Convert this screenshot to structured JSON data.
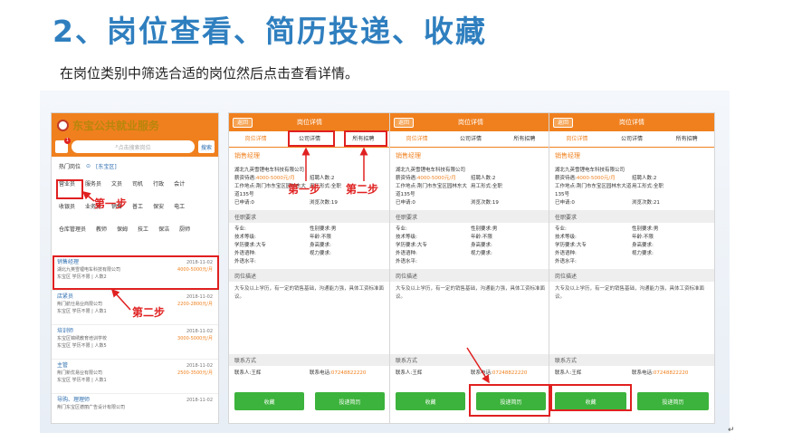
{
  "slide": {
    "title": "2、岗位查看、简历投递、收藏",
    "subtitle": "在岗位类别中筛选合适的岗位然后点击查看详情。"
  },
  "list_screen": {
    "brand": "东宝公共就业服务",
    "badge": "1",
    "search_placeholder": "点击搜索岗位",
    "search_button": "搜索",
    "hot_label": "热门岗位",
    "district": "[东宝区]",
    "tags": [
      "营业员",
      "服务员",
      "文员",
      "司机",
      "行政",
      "会计",
      "收银员",
      "业务员",
      "销售",
      "普工",
      "保安",
      "电工",
      "仓库管理员",
      "教师",
      "保姆",
      "技工",
      "保洁",
      "厨师"
    ],
    "jobs": [
      {
        "title": "销售经理",
        "date": "2018-11-02",
        "salary": "4000-5000元/月",
        "company": "湖北九英雪锂电车科技有限公司",
        "meta": "东宝区 学历不限 | 人数2"
      },
      {
        "title": "店紧员",
        "date": "2018-11-02",
        "salary": "2200-2800元/月",
        "company": "荆门航仕易业商限公司",
        "meta": "东宝区 学历不限 | 人数1"
      },
      {
        "title": "培训师",
        "date": "2018-11-02",
        "salary": "3000-5000元/月",
        "company": "东宝区锦绣教育培训学校",
        "meta": "东宝区 学历不限 | 人数5"
      },
      {
        "title": "主管",
        "date": "2018-11-02",
        "salary": "2500-3500元/月",
        "company": "荆门新优易业有限公司",
        "meta": "东宝区 学历不限 | 人数1"
      },
      {
        "title": "导购、理理师",
        "date": "2018-11-02",
        "salary": "",
        "company": "荆门东宝区德丽广告设计有限公司",
        "meta": ""
      }
    ]
  },
  "detail": {
    "back": "返回",
    "header_title": "岗位详情",
    "tabs": [
      "岗位详情",
      "公司详情",
      "所有招聘"
    ],
    "job_title": "销售经理",
    "company": "湖北九英雪锂电车科技有限公司",
    "salary_label": "薪资待遇:",
    "salary": "4000-5000元/月",
    "hire_label": "招聘人数:",
    "hire_count": "2",
    "address_label": "工作地点:",
    "address": "荆门市东宝区园林东大道135号",
    "worktype_label": "用工形式:",
    "worktype": "全职",
    "applied_label": "已申请:",
    "applied": "0",
    "views_label": "浏览次数:",
    "views": [
      "19",
      "19",
      "21"
    ],
    "req_header": "任职要求",
    "req_rows": [
      [
        "专业:",
        "",
        "性别要求:",
        "男"
      ],
      [
        "技术等级:",
        "",
        "年龄:",
        "不限"
      ],
      [
        "学历要求:",
        "大专",
        "身高要求:",
        ""
      ],
      [
        "外语语种:",
        "",
        "视力要求:",
        ""
      ],
      [
        "外语水平:",
        "",
        "",
        ""
      ]
    ],
    "desc_header": "岗位描述",
    "desc": "大专及以上学历，有一定的销售基础，沟通能力强，具体工资标准面议。",
    "contact_header": "联系方式",
    "contact_label": "联系人:",
    "contact": "王辉",
    "phone_label": "联系电话:",
    "phone": "07248822220",
    "collect_button": "收藏",
    "resume_button": "投递简历"
  },
  "annotations": {
    "step1": "第一步",
    "step2": "第二步"
  },
  "colors": {
    "title_blue": "#2f7fbf",
    "app_orange": "#f0801e",
    "button_green": "#3cb33c",
    "highlight_red": "#e02020"
  },
  "end_mark": "↵"
}
